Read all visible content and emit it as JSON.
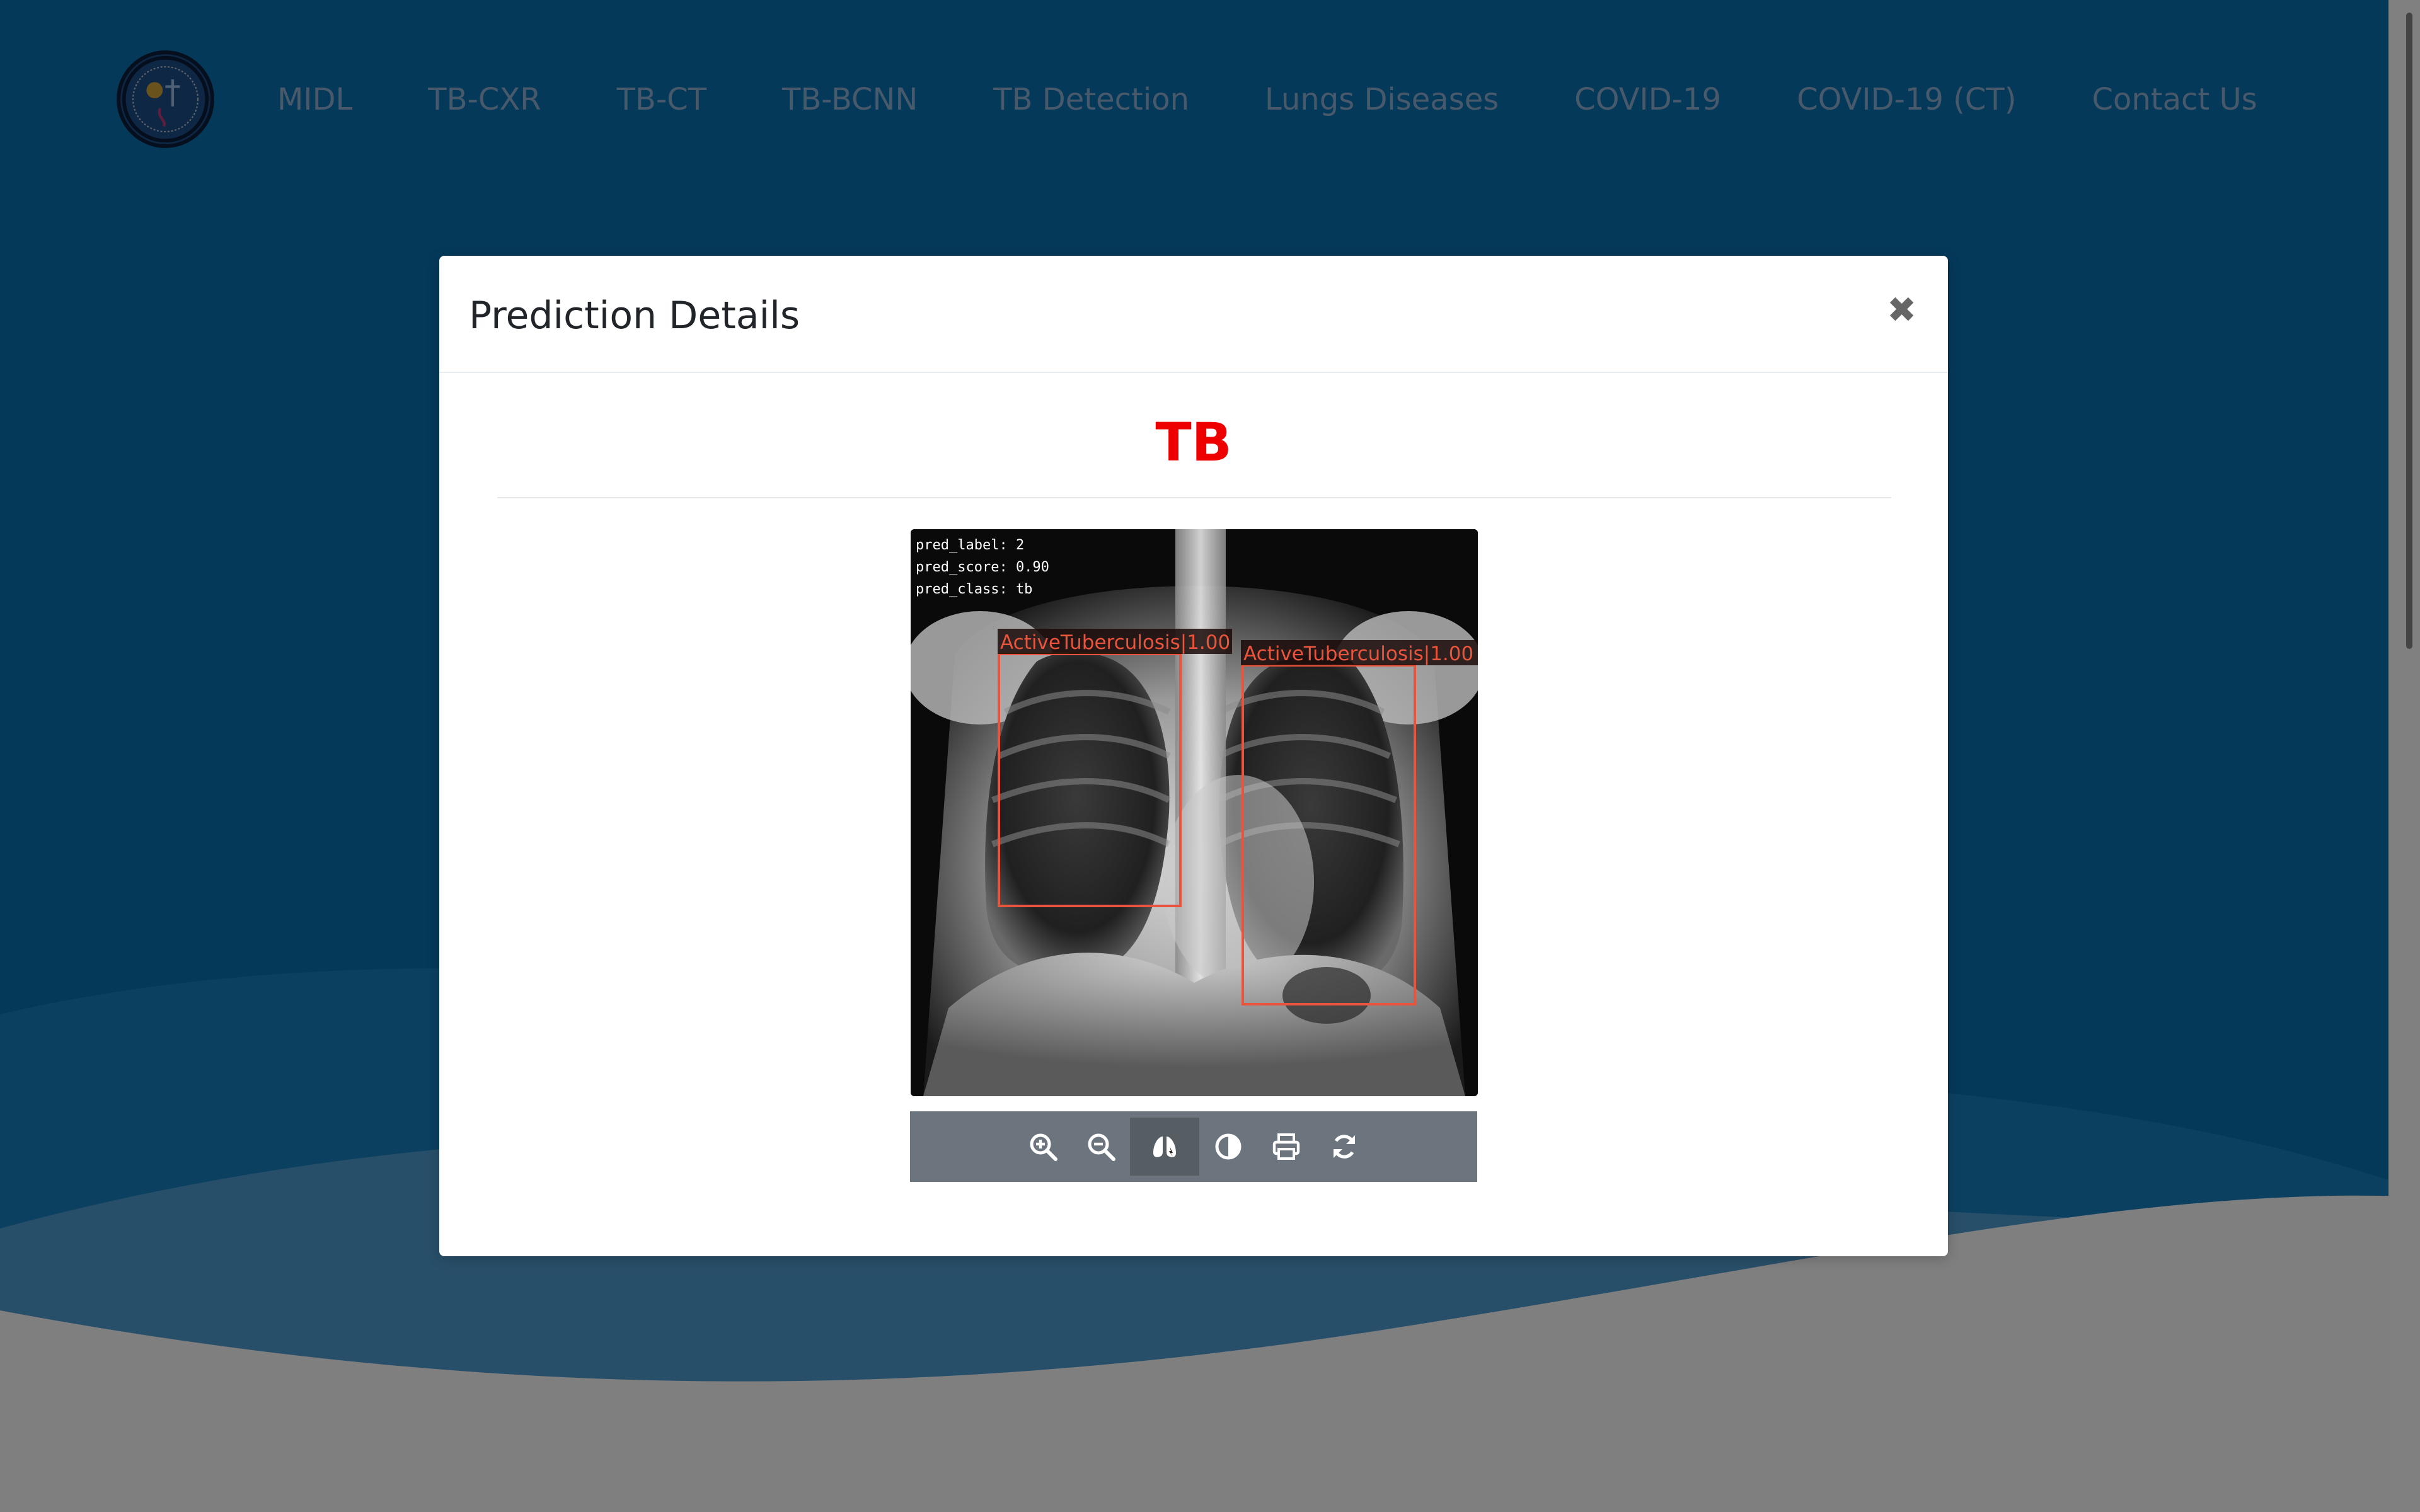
{
  "nav": {
    "items": [
      {
        "label": "MIDL"
      },
      {
        "label": "TB-CXR"
      },
      {
        "label": "TB-CT"
      },
      {
        "label": "TB-BCNN"
      },
      {
        "label": "TB Detection"
      },
      {
        "label": "Lungs Diseases"
      },
      {
        "label": "COVID-19"
      },
      {
        "label": "COVID-19 (CT)"
      },
      {
        "label": "Contact Us"
      }
    ]
  },
  "modal": {
    "title": "Prediction Details",
    "close_glyph": "✖",
    "result_label": "TB",
    "result_color": "#ee0000",
    "image": {
      "overlay_lines": [
        "pred_label: 2",
        "pred_score: 0.90",
        "pred_class: tb"
      ],
      "detections": [
        {
          "label": "ActiveTuberculosis|1.00"
        },
        {
          "label": "ActiveTuberculosis|1.00"
        }
      ],
      "box_color": "#e8543c"
    },
    "toolbar": {
      "buttons": [
        {
          "name": "zoom-in-icon"
        },
        {
          "name": "zoom-out-icon"
        },
        {
          "name": "lungs-icon",
          "active": true
        },
        {
          "name": "contrast-icon"
        },
        {
          "name": "print-icon"
        },
        {
          "name": "refresh-icon"
        }
      ]
    }
  },
  "colors": {
    "page_blue": "#0a72b5",
    "toolbar_bg": "#6c757d",
    "nav_text": "#8fb3d4"
  }
}
